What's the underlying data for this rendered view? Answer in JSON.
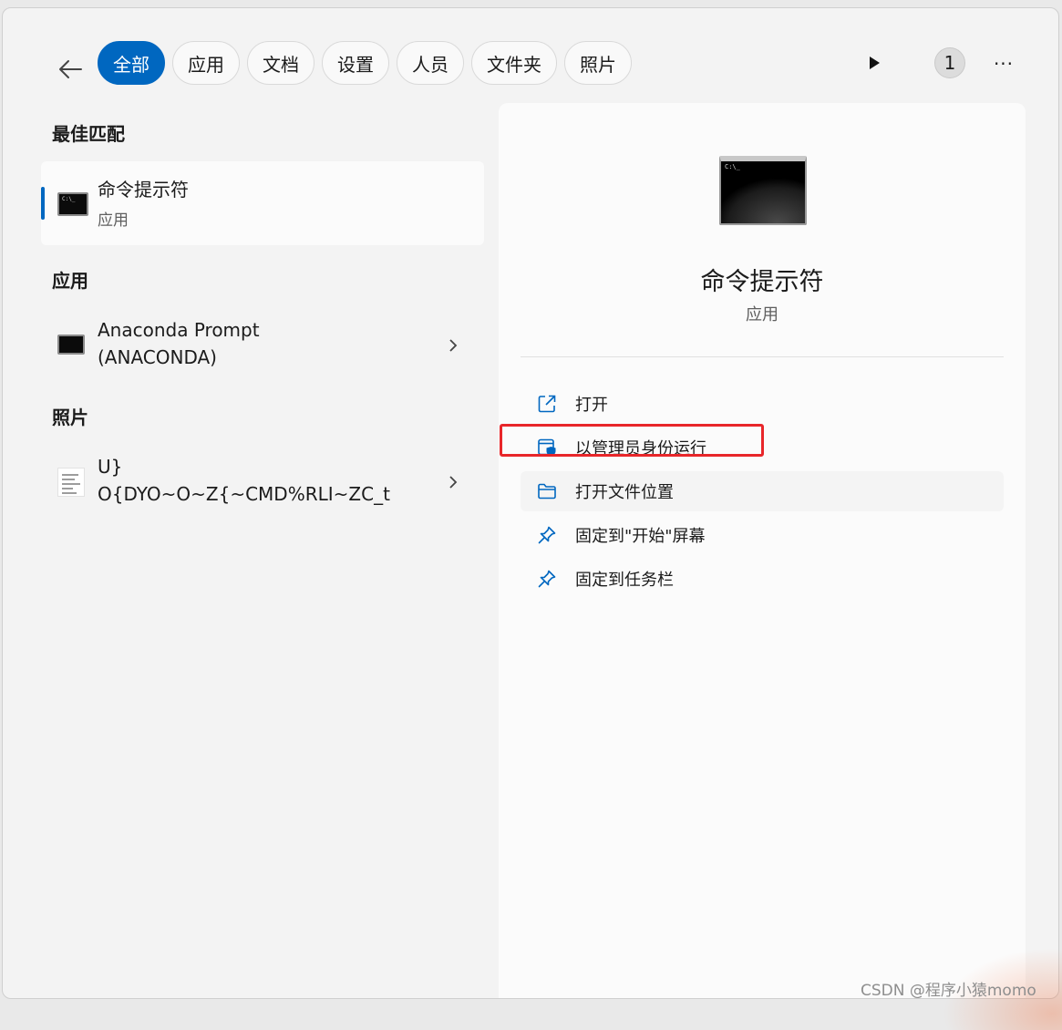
{
  "search": {
    "filters": [
      {
        "label": "全部",
        "active": true
      },
      {
        "label": "应用",
        "active": false
      },
      {
        "label": "文档",
        "active": false
      },
      {
        "label": "设置",
        "active": false
      },
      {
        "label": "人员",
        "active": false
      },
      {
        "label": "文件夹",
        "active": false
      },
      {
        "label": "照片",
        "active": false
      }
    ],
    "count_badge": "1",
    "more_label": "···"
  },
  "best_match": {
    "heading": "最佳匹配",
    "name": "命令提示符",
    "type": "应用",
    "icon": "cmd-icon",
    "icon_text": "C:\\_"
  },
  "apps": {
    "heading": "应用",
    "items": [
      {
        "name_line1": "Anaconda Prompt",
        "name_line2": "(ANACONDA)",
        "icon": "cmd-icon"
      }
    ]
  },
  "photos": {
    "heading": "照片",
    "items": [
      {
        "name_line1": "U}",
        "name_line2": "O{DYO~O~Z{~CMD%RLI~ZC_t",
        "icon": "image-thumbnail-icon"
      }
    ]
  },
  "details": {
    "name": "命令提示符",
    "type": "应用",
    "icon_text": "C:\\_",
    "actions": [
      {
        "label": "打开",
        "icon": "open-external-icon"
      },
      {
        "label": "以管理员身份运行",
        "icon": "admin-shield-icon"
      },
      {
        "label": "打开文件位置",
        "icon": "folder-icon"
      },
      {
        "label": "固定到\"开始\"屏幕",
        "icon": "pin-icon"
      },
      {
        "label": "固定到任务栏",
        "icon": "pin-icon"
      }
    ]
  },
  "colors": {
    "accent": "#0067c0",
    "highlight": "#e8262a"
  },
  "watermark": "CSDN @程序小猿momo"
}
